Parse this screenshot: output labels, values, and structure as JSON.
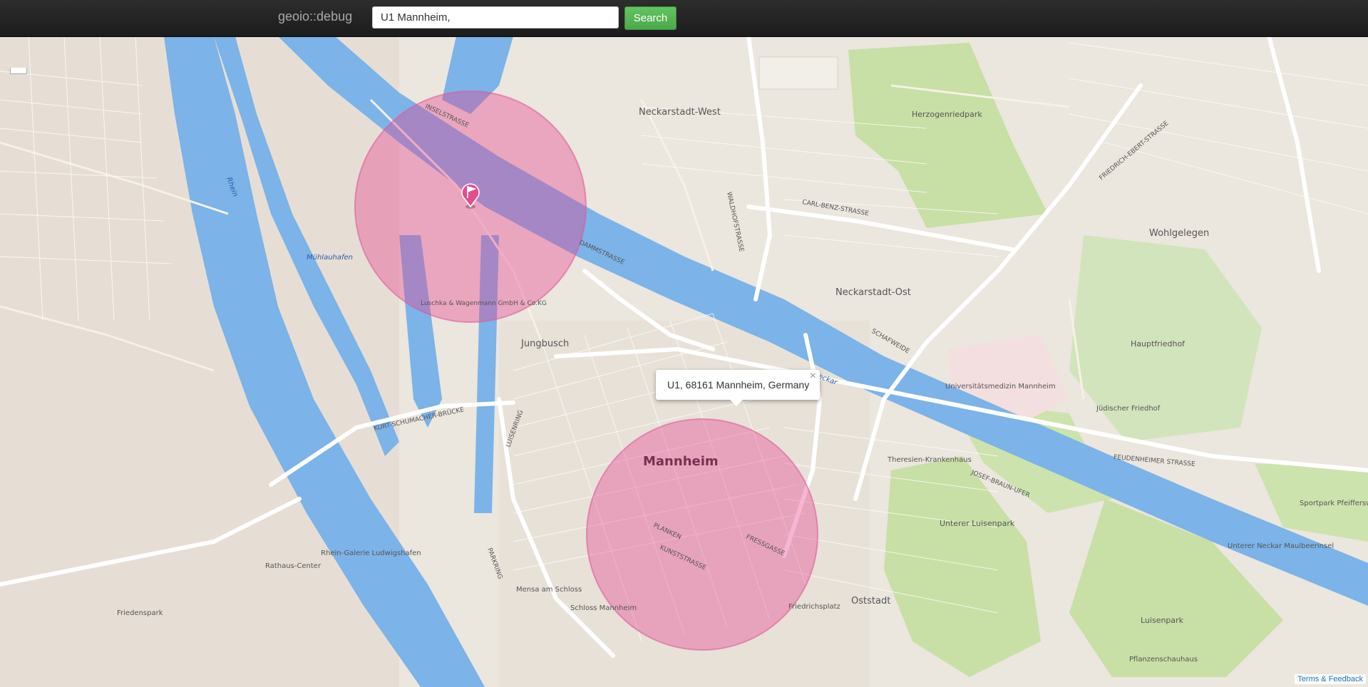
{
  "app": {
    "brand": "geoio::debug"
  },
  "search": {
    "value": "U1 Mannheim,",
    "button_label": "Search"
  },
  "popup": {
    "text": "U1, 68161 Mannheim, Germany",
    "close_glyph": "×"
  },
  "attribution": {
    "text": "Terms & Feedback"
  },
  "markers": [
    {
      "name": "flag-marker-icon",
      "color": "#e0508f"
    },
    {
      "name": "close-marker-icon",
      "color": "#000000"
    }
  ],
  "map_labels": {
    "mannheim": "Mannheim",
    "neckarstadt_west": "Neckarstadt-West",
    "neckarstadt_ost": "Neckarstadt-Ost",
    "jungbusch": "Jungbusch",
    "herzogenriedpark": "Herzogenriedpark",
    "wohlgelegen": "Wohlgelegen",
    "hauptfriedhof": "Hauptfriedhof",
    "juedischer_friedhof": "Jüdischer Friedhof",
    "universitaetsmedizin": "Universitätsmedizin Mannheim",
    "theresien": "Theresien-Krankenhaus",
    "unterer_luisenpark": "Unterer Luisenpark",
    "luisenpark": "Luisenpark",
    "oststadt": "Oststadt",
    "friedrichsplatz": "Friedrichsplatz",
    "muehlauhafen": "Mühlauhafen",
    "luschka": "Luschka & Wagenmann GmbH & Co.KG",
    "rathaus_center": "Rathaus-Center",
    "rhein_galerie": "Rhein-Galerie Ludwigshafen",
    "friedenspark": "Friedenspark",
    "mensa": "Mensa am Schloss",
    "schloss": "Schloss Mannheim",
    "sportpark": "Sportpark Pfeifferswörth",
    "unterer_neckar": "Unterer Neckar Maulbeerinsel",
    "pflanzenschauhaus": "Pflanzenschauhaus",
    "neckar": "Neckar",
    "rhein": "Rhein",
    "kurt_schumacher": "KURT-SCHUMACHER-BRÜCKE",
    "feudenheimer": "FEUDENHEIMER STRASSE",
    "dammstrasse": "DAMMSTRASSE",
    "carl_benz": "CARL-BENZ-STRASSE",
    "josef_braun": "JOSEF-BRAUN-UFER",
    "inselstrasse": "INSELSTRASSE",
    "kunststrasse": "KUNSTSTRASSE",
    "planken": "PLANKEN",
    "fressgasse": "FRESSGASSE",
    "luisenring": "LUISENRING",
    "parkring": "PARKRING",
    "friedrich_ebert": "FRIEDRICH-EBERT-STRASSE",
    "waldhofstrasse": "WALDHOFSTRASSE",
    "schafweide": "SCHAFWEIDE"
  }
}
